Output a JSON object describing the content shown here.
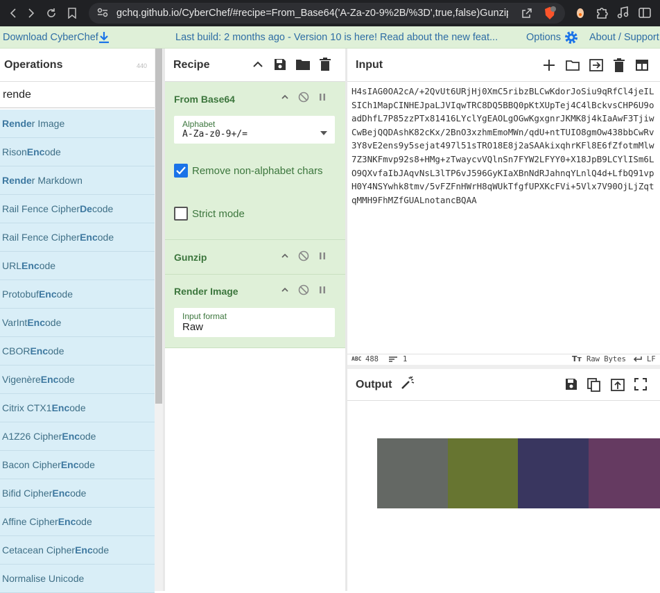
{
  "browser": {
    "url": "gchq.github.io/CyberChef/#recipe=From_Base64('A-Za-z0-9%2B/%3D',true,false)Gunzip()..."
  },
  "banner": {
    "download": "Download CyberChef",
    "build": "Last build: 2 months ago - Version 10 is here! Read about the new feat...",
    "options": "Options",
    "about": "About / Support"
  },
  "operations": {
    "title": "Operations",
    "count": "440",
    "search_value": "rende",
    "items": [
      {
        "pre": "",
        "hl": "Rende",
        "post": "r Image"
      },
      {
        "pre": "R",
        "hl": "ison ",
        "post": ""
      },
      {
        "pre": "",
        "hl": "Rende",
        "post": "r Markdown"
      },
      {
        "pre": "",
        "hl": "R",
        "post": "ail Fence Cipher Decode"
      },
      {
        "pre": "",
        "hl": "R",
        "post": "ail Fence Cipher Encode"
      },
      {
        "pre": "U",
        "hl": "R",
        "post": "L Encode"
      },
      {
        "pre": "P",
        "hl": "r",
        "post": "otobuf Encode"
      },
      {
        "pre": "Va",
        "hl": "r",
        "post": "Int Encode"
      },
      {
        "pre": "CBO",
        "hl": "R",
        "post": " Encode"
      },
      {
        "pre": "Vigenère ",
        "hl": "Enc",
        "post": "ode"
      },
      {
        "pre": "Cit",
        "hl": "r",
        "post": "ix CTX1 Encode"
      },
      {
        "pre": "A1Z26 Ciphe",
        "hl": "r",
        "post": " Encode"
      },
      {
        "pre": "Bacon Ciphe",
        "hl": "r",
        "post": " Encode"
      },
      {
        "pre": "Bifid Ciphe",
        "hl": "r",
        "post": " Encode"
      },
      {
        "pre": "Affine Ciphe",
        "hl": "r",
        "post": " Encode"
      },
      {
        "pre": "Cetacean Ciphe",
        "hl": "r",
        "post": " Encode"
      },
      {
        "pre": "No",
        "hl": "r",
        "post": "malise Unicode"
      }
    ],
    "labels": [
      "Render Image",
      "Rison Encode",
      "Render Markdown",
      "Rail Fence Cipher Decode",
      "Rail Fence Cipher Encode",
      "URL Encode",
      "Protobuf Encode",
      "VarInt Encode",
      "CBOR Encode",
      "Vigenère Encode",
      "Citrix CTX1 Encode",
      "A1Z26 Cipher Encode",
      "Bacon Cipher Encode",
      "Bifid Cipher Encode",
      "Affine Cipher Encode",
      "Cetacean Cipher Encode",
      "Normalise Unicode"
    ]
  },
  "recipe": {
    "title": "Recipe",
    "ops": [
      {
        "name": "From Base64",
        "alphabet_label": "Alphabet",
        "alphabet_value": "A-Za-z0-9+/=",
        "remove_label": "Remove non-alphabet chars",
        "remove_checked": true,
        "strict_label": "Strict mode",
        "strict_checked": false
      },
      {
        "name": "Gunzip"
      },
      {
        "name": "Render Image",
        "format_label": "Input format",
        "format_value": "Raw"
      }
    ]
  },
  "input": {
    "title": "Input",
    "text": "H4sIAG0OA2cA/+2QvUt6URjHj0XmC5ribzBLCwKdorJoSiu9qRfCl4jeILSICh1MapCINHEJpaLJVIqwTRC8DQ5BBQ0pKtXUpTej4C4lBckvsCHP6U9oadDhfL7P85zzPTx81416LYclYgEAOLgOGwKgxgnrJKMK8j4kIaAwF3TjiwCwBejQQDAshK82cKx/2BnO3xzhmEmoMWn/qdU+ntTUIO8gmOw438bbCwRv3Y8vE2ens9y5sejat497l51sTRO18E8j2aSAAkixqhrKFl8E6fZfotmMlw7Z3NKFmvp92s8+HMg+zTwaycvVQlnSn7FYW2LFYY0+X18JpB9LCYlISm6LO9QXvfaIbJAqvNsL3lTP6vJ596GyKIaXBnNdRJahnqYLnlQ4d+LfbQ91vpH0Y4NSYwhk8tmv/5vFZFnHWrH8qWUkTfgfUPXKcFVi+5Vlx7V90OjLjZqtqMMH9FhMZfGUALnotancBQAA",
    "chars": "488",
    "lines": "1",
    "raw_bytes": "Raw Bytes",
    "eol": "LF"
  },
  "output": {
    "title": "Output",
    "swatches": [
      "#646864",
      "#677531",
      "#39365f",
      "#653a61"
    ]
  }
}
